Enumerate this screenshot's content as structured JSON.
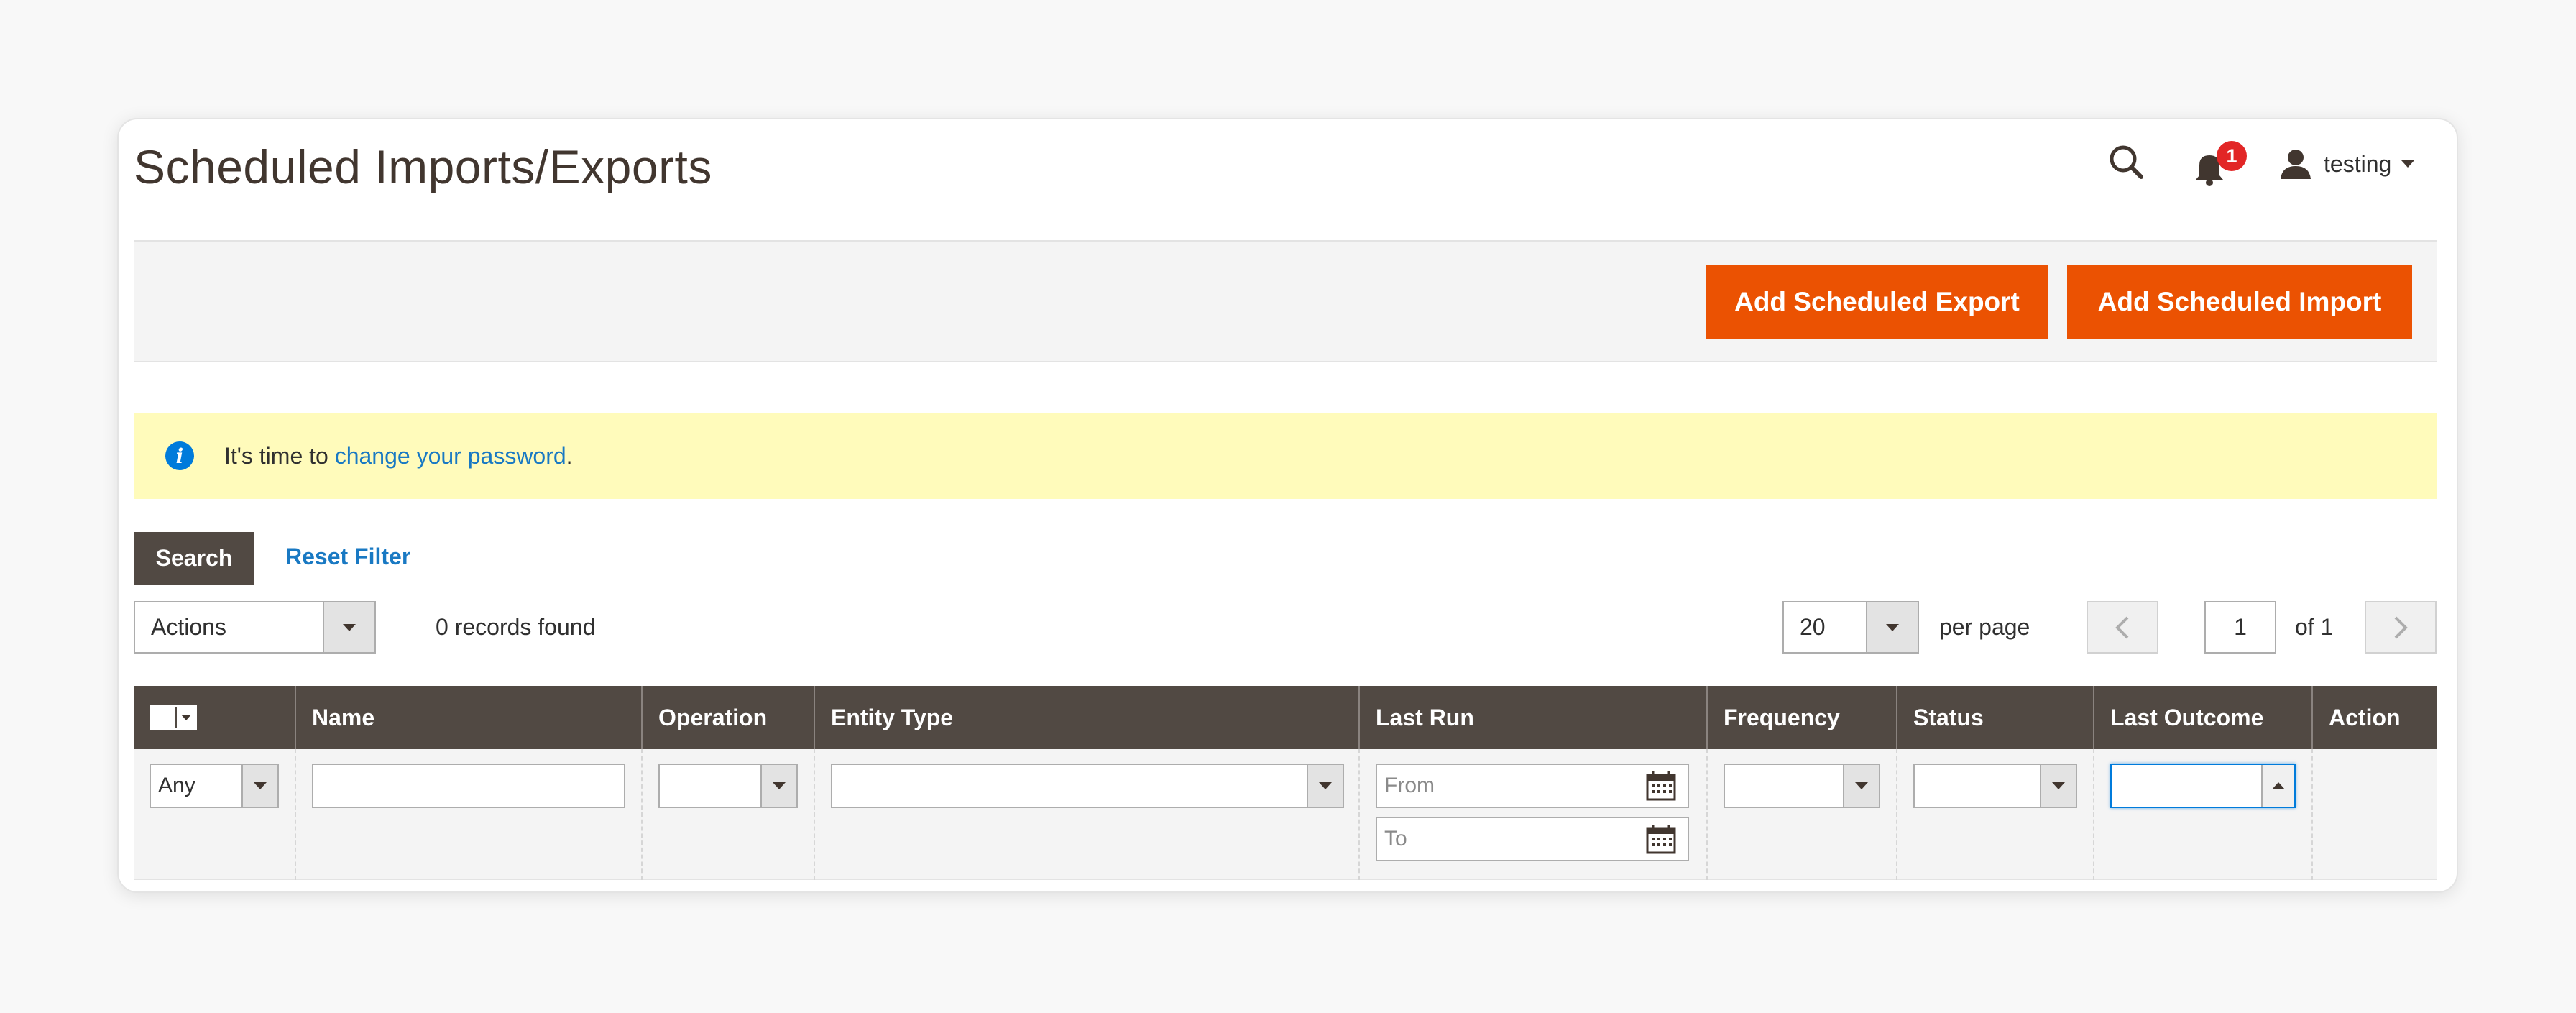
{
  "header": {
    "title": "Scheduled Imports/Exports",
    "notification_count": "1",
    "user_name": "testing"
  },
  "action_bar": {
    "add_export_label": "Add Scheduled Export",
    "add_import_label": "Add Scheduled Import"
  },
  "notice": {
    "text": "It's time to ",
    "link_text": "change your password",
    "trailing": "."
  },
  "filters": {
    "search_label": "Search",
    "reset_label": "Reset Filter"
  },
  "toolbar": {
    "actions_label": "Actions",
    "records_found": "0 records found",
    "per_page_value": "20",
    "per_page_label": "per page",
    "current_page": "1",
    "page_of": "of 1"
  },
  "grid": {
    "columns": [
      "Name",
      "Operation",
      "Entity Type",
      "Last Run",
      "Frequency",
      "Status",
      "Last Outcome",
      "Action"
    ],
    "filter_any": "Any",
    "date_from_placeholder": "From",
    "date_to_placeholder": "To"
  },
  "colors": {
    "primary_button": "#eb5202",
    "header_dark": "#514943",
    "notice_bg": "#fffbbb",
    "link": "#1979c3",
    "badge": "#e22626"
  }
}
